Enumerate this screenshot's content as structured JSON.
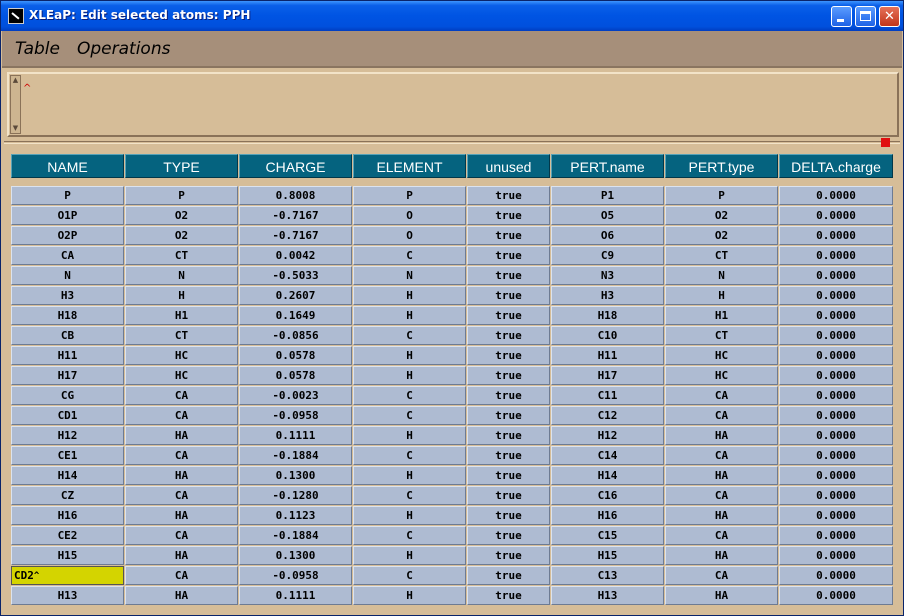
{
  "window": {
    "title": "XLEaP: Edit selected atoms: PPH",
    "buttons": {
      "minimize": "_",
      "maximize": "□",
      "close": "✕"
    }
  },
  "menubar": {
    "items": [
      "Table",
      "Operations"
    ]
  },
  "text_panel": {
    "caret": "^"
  },
  "table": {
    "columns": [
      "NAME",
      "TYPE",
      "CHARGE",
      "ELEMENT",
      "unused",
      "PERT.name",
      "PERT.type",
      "DELTA.charge"
    ],
    "rows": [
      [
        "P",
        "P",
        "0.8008",
        "P",
        "true",
        "P1",
        "P",
        "0.0000"
      ],
      [
        "O1P",
        "O2",
        "-0.7167",
        "O",
        "true",
        "O5",
        "O2",
        "0.0000"
      ],
      [
        "O2P",
        "O2",
        "-0.7167",
        "O",
        "true",
        "O6",
        "O2",
        "0.0000"
      ],
      [
        "CA",
        "CT",
        "0.0042",
        "C",
        "true",
        "C9",
        "CT",
        "0.0000"
      ],
      [
        "N",
        "N",
        "-0.5033",
        "N",
        "true",
        "N3",
        "N",
        "0.0000"
      ],
      [
        "H3",
        "H",
        "0.2607",
        "H",
        "true",
        "H3",
        "H",
        "0.0000"
      ],
      [
        "H18",
        "H1",
        "0.1649",
        "H",
        "true",
        "H18",
        "H1",
        "0.0000"
      ],
      [
        "CB",
        "CT",
        "-0.0856",
        "C",
        "true",
        "C10",
        "CT",
        "0.0000"
      ],
      [
        "H11",
        "HC",
        "0.0578",
        "H",
        "true",
        "H11",
        "HC",
        "0.0000"
      ],
      [
        "H17",
        "HC",
        "0.0578",
        "H",
        "true",
        "H17",
        "HC",
        "0.0000"
      ],
      [
        "CG",
        "CA",
        "-0.0023",
        "C",
        "true",
        "C11",
        "CA",
        "0.0000"
      ],
      [
        "CD1",
        "CA",
        "-0.0958",
        "C",
        "true",
        "C12",
        "CA",
        "0.0000"
      ],
      [
        "H12",
        "HA",
        "0.1111",
        "H",
        "true",
        "H12",
        "HA",
        "0.0000"
      ],
      [
        "CE1",
        "CA",
        "-0.1884",
        "C",
        "true",
        "C14",
        "CA",
        "0.0000"
      ],
      [
        "H14",
        "HA",
        "0.1300",
        "H",
        "true",
        "H14",
        "HA",
        "0.0000"
      ],
      [
        "CZ",
        "CA",
        "-0.1280",
        "C",
        "true",
        "C16",
        "CA",
        "0.0000"
      ],
      [
        "H16",
        "HA",
        "0.1123",
        "H",
        "true",
        "H16",
        "HA",
        "0.0000"
      ],
      [
        "CE2",
        "CA",
        "-0.1884",
        "C",
        "true",
        "C15",
        "CA",
        "0.0000"
      ],
      [
        "H15",
        "HA",
        "0.1300",
        "H",
        "true",
        "H15",
        "HA",
        "0.0000"
      ],
      [
        "CD2",
        "CA",
        "-0.0958",
        "C",
        "true",
        "C13",
        "CA",
        "0.0000"
      ],
      [
        "H13",
        "HA",
        "0.1111",
        "H",
        "true",
        "H13",
        "HA",
        "0.0000"
      ]
    ],
    "editing_cell": {
      "row": 19,
      "col": 0
    }
  },
  "colors": {
    "header_bg": "#05637f",
    "cell_bg": "#aebbd2",
    "editing_bg": "#d4d400",
    "window_bg": "#d6bd98",
    "menubar_bg": "#a68f7a"
  }
}
